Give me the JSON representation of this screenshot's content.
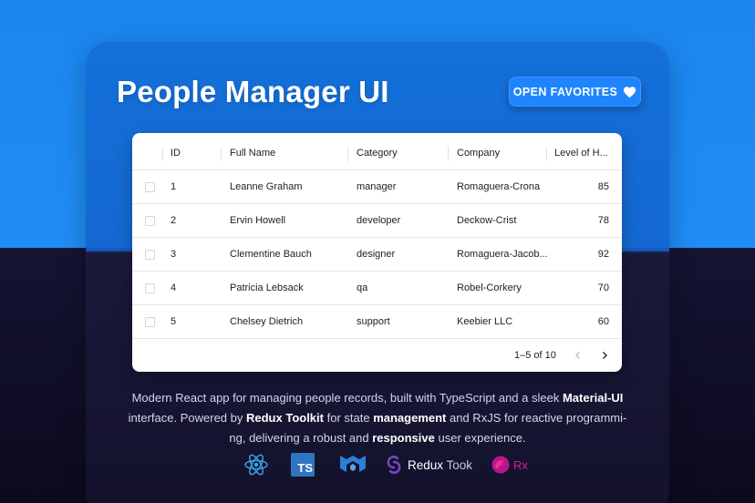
{
  "page": {
    "title": "People Manager UI",
    "favorites_button": "OPEN FAVORITES"
  },
  "table": {
    "columns": [
      "ID",
      "Full Name",
      "Category",
      "Company",
      "Level of H..."
    ],
    "rows": [
      {
        "id": "1",
        "name": "Leanne Graham",
        "category": "manager",
        "company": "Romaguera-Crona",
        "level": "85"
      },
      {
        "id": "2",
        "name": "Ervin Howell",
        "category": "developer",
        "company": "Deckow-Crist",
        "level": "78"
      },
      {
        "id": "3",
        "name": "Clementine Bauch",
        "category": "designer",
        "company": "Romaguera-Jacob...",
        "level": "92"
      },
      {
        "id": "4",
        "name": "Patricia Lebsack",
        "category": "qa",
        "company": "Robel-Corkery",
        "level": "70"
      },
      {
        "id": "5",
        "name": "Chelsey Dietrich",
        "category": "support",
        "company": "Keebier LLC",
        "level": "60"
      }
    ],
    "pagination": "1–5 of 10"
  },
  "description": {
    "p1": "Modern React app for managing people records, built with TypeScript and a sleek ",
    "b1": "Material-UI",
    "p2": " interface. Powered by ",
    "b2": "Redux Toolkit",
    "p3": " for state ",
    "b3": "management",
    "p4": " and RxJS for reactive programmi- ng, delivering a robust and ",
    "b4": "responsive",
    "p5": " user experience."
  },
  "tech_logos": {
    "react": "react-icon",
    "ts": "TS",
    "mui": "mui-icon",
    "redux_bold": "Redux",
    "redux_light": " Took",
    "rx": "Rx"
  },
  "colors": {
    "primary": "#1f85ff",
    "top_bg": "#1b86f0",
    "bottom_bg": "#0e0c22",
    "ts_blue": "#2f74c0",
    "react_blue": "#3aa8f5",
    "mui_blue": "#2d7fd8",
    "redux_purple": "#7a4ac6",
    "rx_pink": "#d0208f"
  }
}
